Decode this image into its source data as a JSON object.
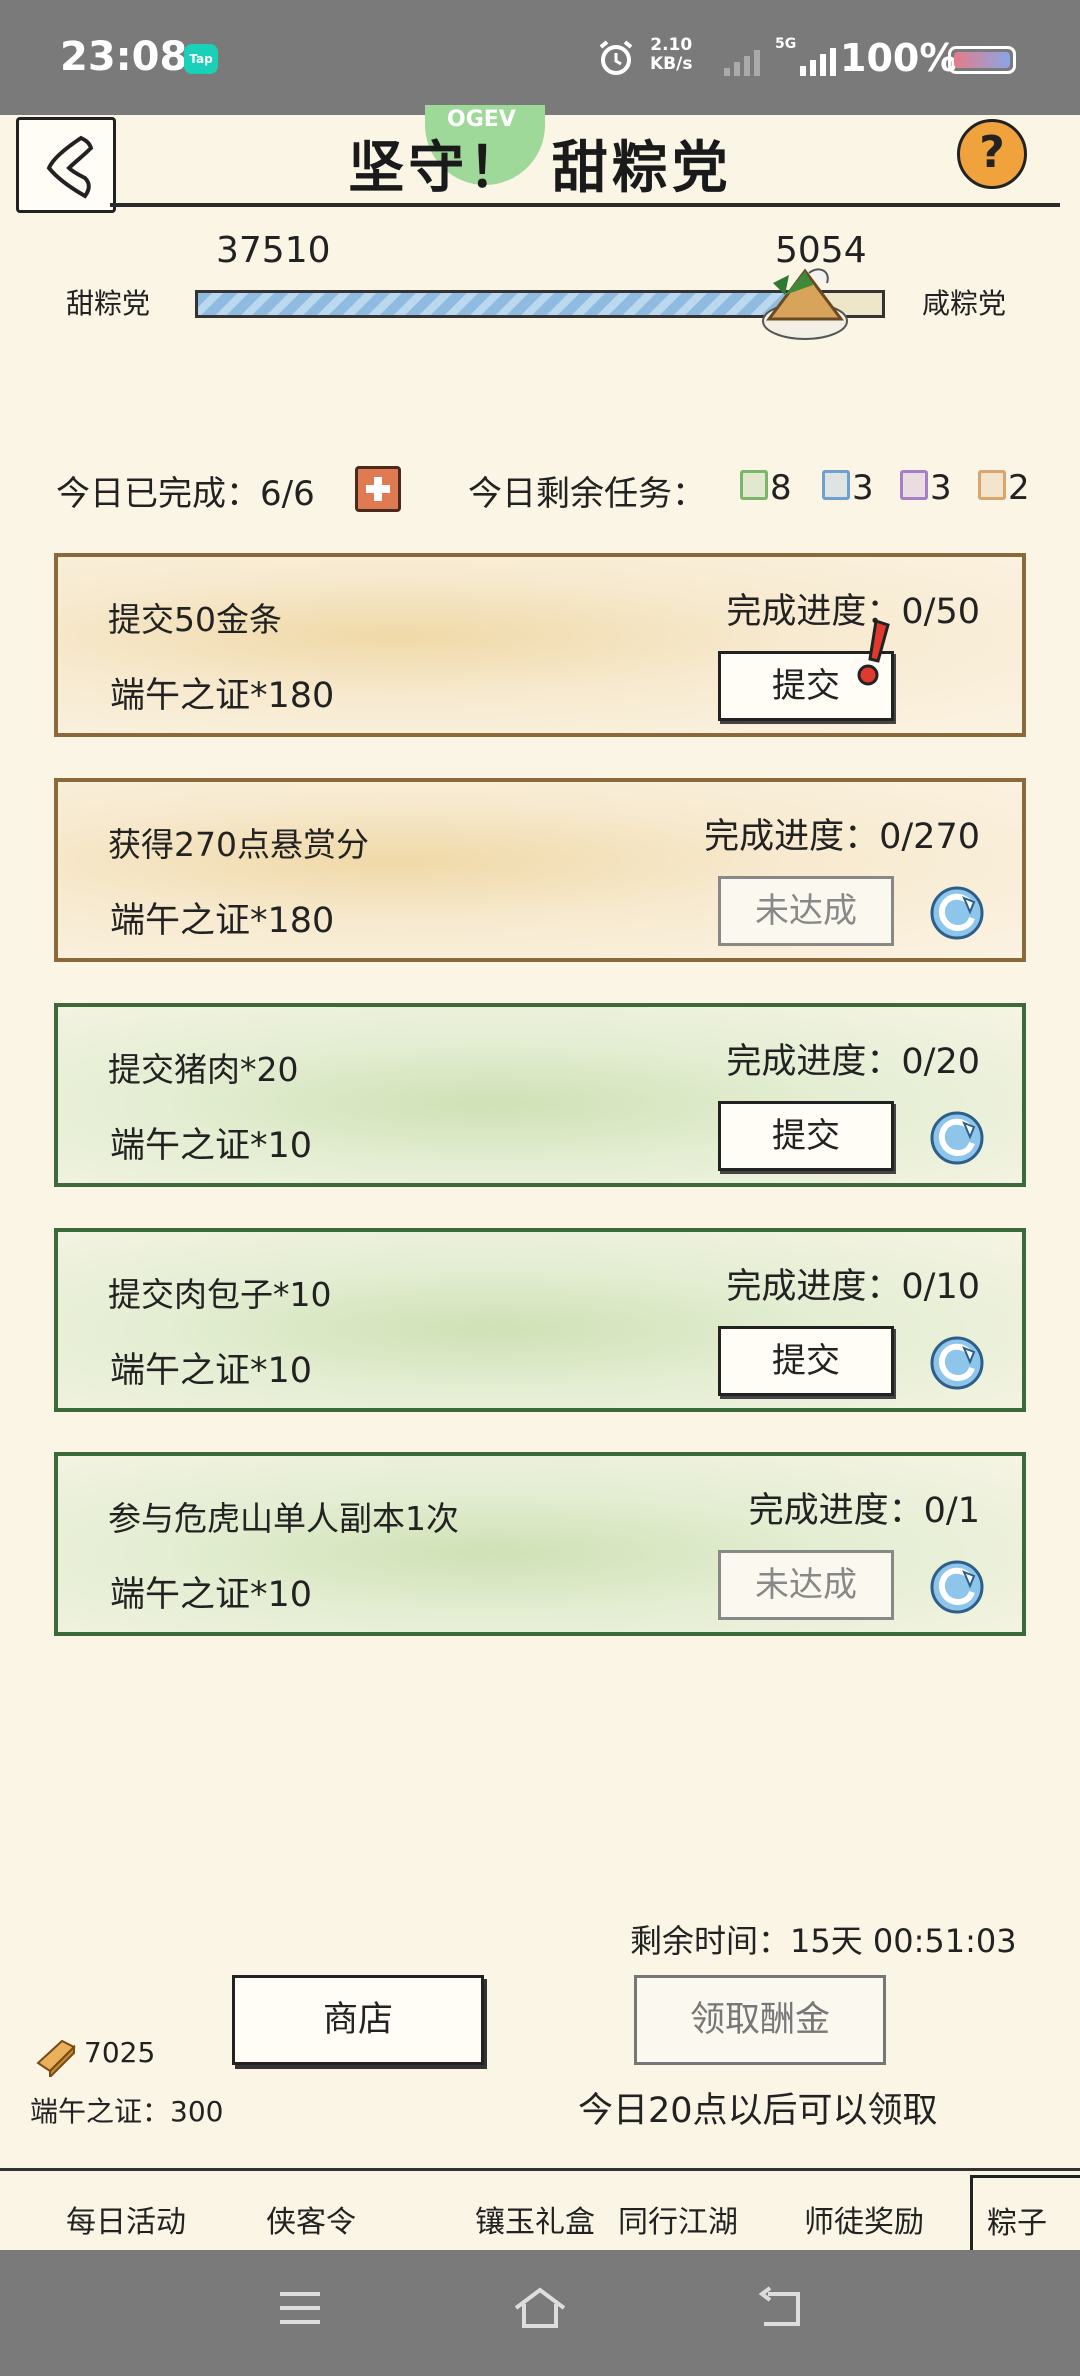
{
  "status_bar": {
    "time": "23:08",
    "app_badge": "Tap",
    "net_speed_value": "2.10",
    "net_speed_unit": "KB/s",
    "network_type": "5G",
    "battery": "100%"
  },
  "header": {
    "title": "坚守！ 甜粽党",
    "title_badge": "OGEV",
    "help_label": "?"
  },
  "vote": {
    "left_label": "甜粽党",
    "right_label": "咸粽党",
    "left_count": "37510",
    "right_count": "5054",
    "left_share": 0.881
  },
  "stats": {
    "done_label": "今日已完成：6/6",
    "remain_label": "今日剩余任务：",
    "chips": [
      {
        "color": "#7cb46a",
        "count": "8"
      },
      {
        "color": "#6fa0cf",
        "count": "3"
      },
      {
        "color": "#a77fc6",
        "count": "3"
      },
      {
        "color": "#d9a56a",
        "count": "2"
      }
    ]
  },
  "tasks": [
    {
      "name": "提交50金条",
      "reward": "端午之证*180",
      "progress": "完成进度：0/50",
      "button": "提交",
      "state": "active",
      "style": "gold",
      "alert": true,
      "refresh": false
    },
    {
      "name": "获得270点悬赏分",
      "reward": "端午之证*180",
      "progress": "完成进度：0/270",
      "button": "未达成",
      "state": "disabled",
      "style": "gold",
      "alert": false,
      "refresh": true
    },
    {
      "name": "提交猪肉*20",
      "reward": "端午之证*10",
      "progress": "完成进度：0/20",
      "button": "提交",
      "state": "active",
      "style": "green",
      "alert": false,
      "refresh": true
    },
    {
      "name": "提交肉包子*10",
      "reward": "端午之证*10",
      "progress": "完成进度：0/10",
      "button": "提交",
      "state": "active",
      "style": "green",
      "alert": false,
      "refresh": true
    },
    {
      "name": "参与危虎山单人副本1次",
      "reward": "端午之证*10",
      "progress": "完成进度：0/1",
      "button": "未达成",
      "state": "disabled",
      "style": "green",
      "alert": false,
      "refresh": true
    }
  ],
  "bottom": {
    "time_left": "剩余时间：15天 00:51:03",
    "shop_label": "商店",
    "claim_label": "领取酬金",
    "gold_count": "7025",
    "token_label": "端午之证：300",
    "claim_note": "今日20点以后可以领取"
  },
  "tabs": [
    {
      "label": "每日活动",
      "active": false
    },
    {
      "label": "侠客令",
      "active": false
    },
    {
      "label": "镶玉礼盒",
      "active": false
    },
    {
      "label": "同行江湖",
      "active": false
    },
    {
      "label": "师徒奖励",
      "active": false
    },
    {
      "label": "粽子",
      "active": true
    }
  ]
}
